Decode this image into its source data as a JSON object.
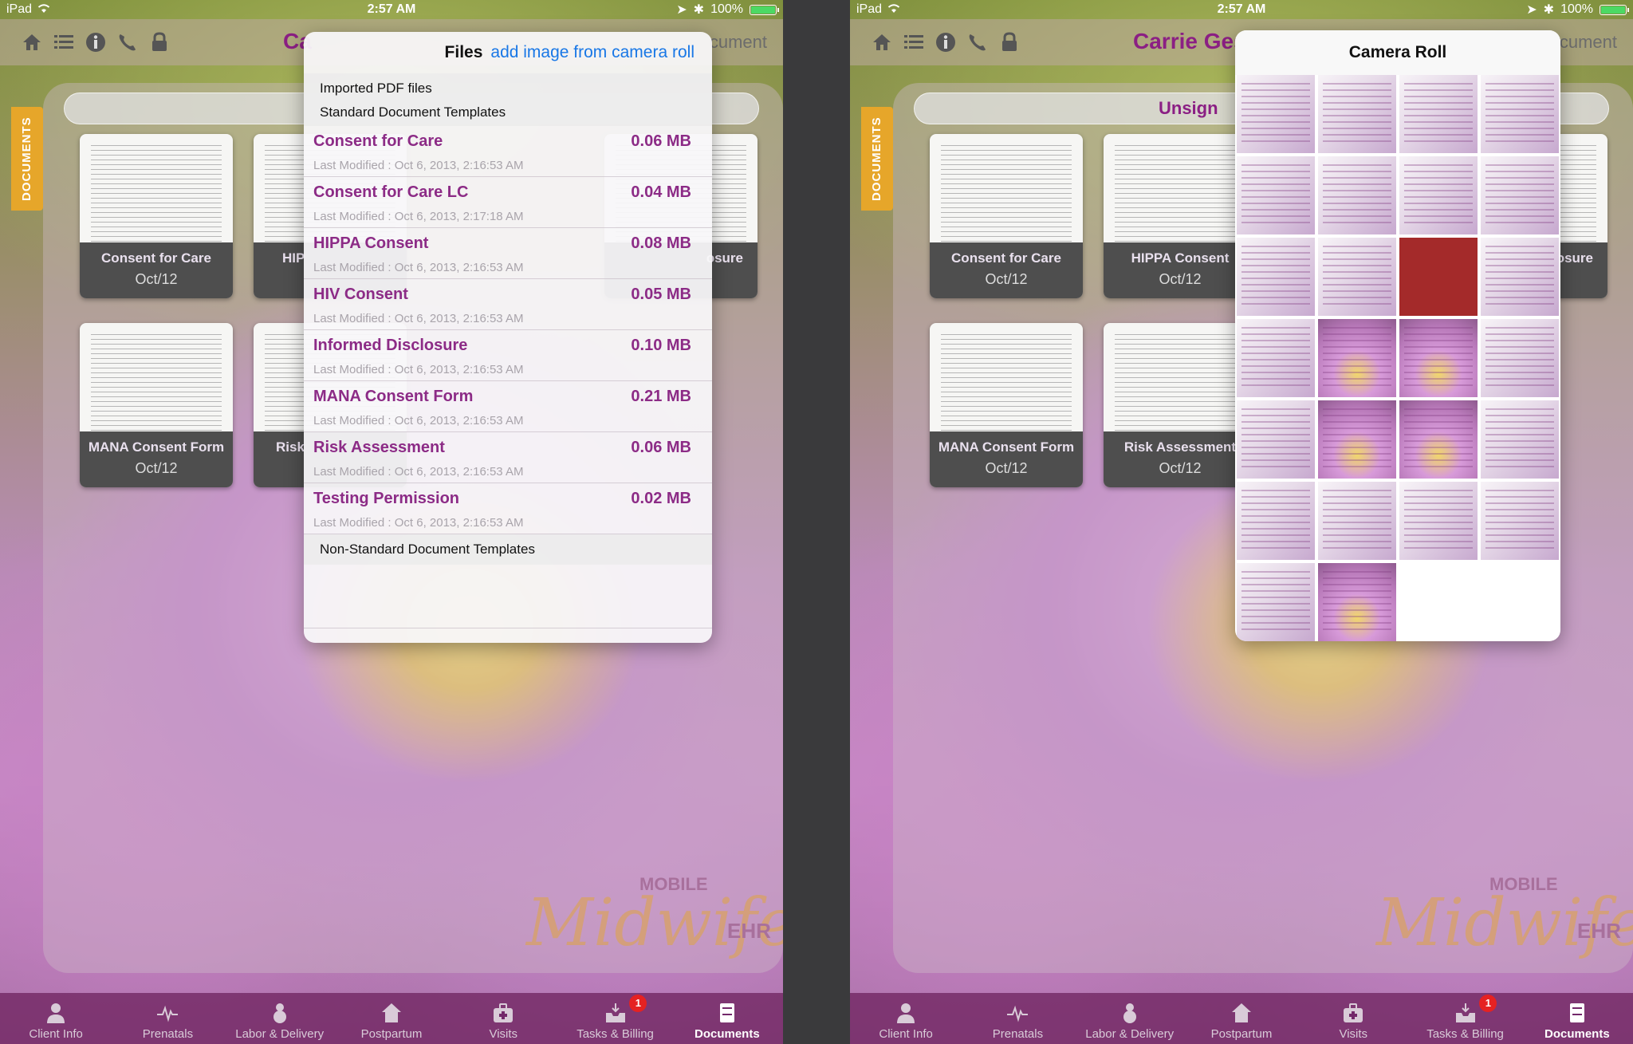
{
  "status_bar": {
    "device": "iPad",
    "time": "2:57 AM",
    "battery": "100%"
  },
  "left_screen": {
    "nav_title_visible": "Ca",
    "nav_right_visible": "cument",
    "thumbnails": [
      {
        "title": "Consent for Care",
        "date": "Oct/12"
      },
      {
        "title": "HIP",
        "date": ""
      },
      {
        "title": "osure",
        "date": ""
      },
      {
        "title": "MANA Consent Form",
        "date": "Oct/12"
      },
      {
        "title": "Risk",
        "date": ""
      }
    ],
    "files_popover": {
      "title": "Files",
      "action": "add image from camera roll",
      "section_imported": "Imported PDF files",
      "section_standard": "Standard Document Templates",
      "section_nonstandard": "Non-Standard Document Templates",
      "files": [
        {
          "name": "Consent for Care",
          "size": "0.06 MB",
          "modified": "Last Modified : Oct 6, 2013, 2:16:53 AM"
        },
        {
          "name": "Consent for Care LC",
          "size": "0.04 MB",
          "modified": "Last Modified : Oct 6, 2013, 2:17:18 AM"
        },
        {
          "name": "HIPPA Consent",
          "size": "0.08 MB",
          "modified": "Last Modified : Oct 6, 2013, 2:16:53 AM"
        },
        {
          "name": "HIV Consent",
          "size": "0.05 MB",
          "modified": "Last Modified : Oct 6, 2013, 2:16:53 AM"
        },
        {
          "name": "Informed Disclosure",
          "size": "0.10 MB",
          "modified": "Last Modified : Oct 6, 2013, 2:16:53 AM"
        },
        {
          "name": "MANA Consent Form",
          "size": "0.21 MB",
          "modified": "Last Modified : Oct 6, 2013, 2:16:53 AM"
        },
        {
          "name": "Risk Assessment",
          "size": "0.06 MB",
          "modified": "Last Modified : Oct 6, 2013, 2:16:53 AM"
        },
        {
          "name": "Testing Permission",
          "size": "0.02 MB",
          "modified": "Last Modified : Oct 6, 2013, 2:16:53 AM"
        }
      ]
    }
  },
  "right_screen": {
    "nav_title_visible": "Carrie Ges",
    "nav_right_visible": "cument",
    "segment_visible": "Unsign",
    "thumbnails": [
      {
        "title": "Consent for Care",
        "date": "Oct/12"
      },
      {
        "title": "HIPPA Consent",
        "date": "Oct/12"
      },
      {
        "title": "osure",
        "date": ""
      },
      {
        "title": "MANA Consent Form",
        "date": "Oct/12"
      },
      {
        "title": "Risk Assessment",
        "date": "Oct/12"
      }
    ],
    "camera_roll": {
      "title": "Camera Roll",
      "photo_count": 26
    }
  },
  "documents_tab_label": "DOCUMENTS",
  "logo": {
    "mobile": "MOBILE",
    "main": "Midwife",
    "ehr": "EHR"
  },
  "tab_bar": {
    "items": [
      {
        "label": "Client Info",
        "icon": "person-icon"
      },
      {
        "label": "Prenatals",
        "icon": "heartbeat-icon"
      },
      {
        "label": "Labor & Delivery",
        "icon": "baby-icon"
      },
      {
        "label": "Postpartum",
        "icon": "house-icon"
      },
      {
        "label": "Visits",
        "icon": "medical-bag-icon"
      },
      {
        "label": "Tasks & Billing",
        "icon": "inbox-icon",
        "badge": "1"
      },
      {
        "label": "Documents",
        "icon": "cabinet-icon",
        "active": true
      }
    ]
  },
  "colors": {
    "accent": "#8b1f84",
    "link": "#1877e6",
    "tab_bar": "#73286a",
    "badge": "#e52222",
    "documents_tab": "#e6a62a"
  }
}
